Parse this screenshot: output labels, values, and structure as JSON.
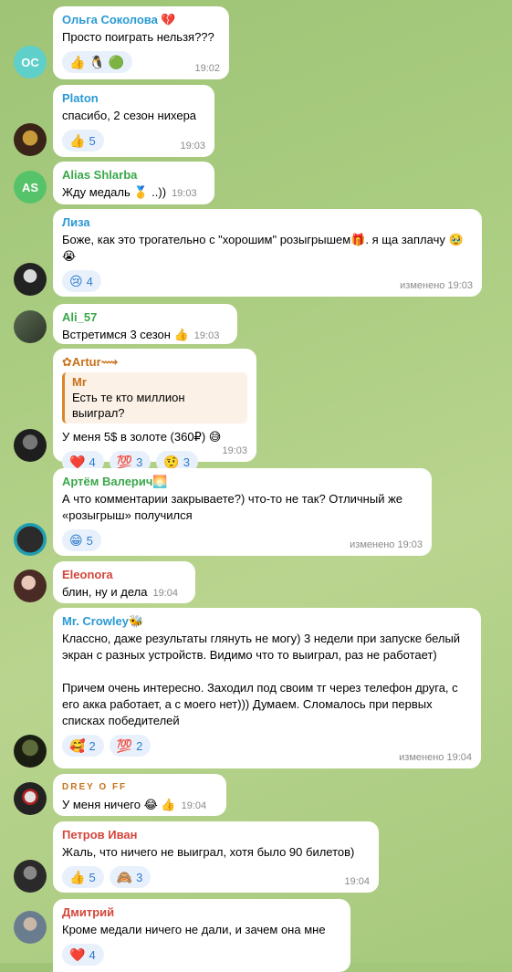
{
  "messages": [
    {
      "name": "Ольга Соколова 💔",
      "text": "Просто поиграть нельзя???",
      "time": "19:02",
      "initials": "ОС",
      "reactions": [
        {
          "emoji": "👍",
          "count": ""
        },
        {
          "emoji": "🐧",
          "count": ""
        },
        {
          "emoji": "🟢",
          "count": ""
        }
      ]
    },
    {
      "name": "Platon",
      "text": "спасибо, 2 сезон нихера",
      "time": "19:03",
      "reactions": [
        {
          "emoji": "👍",
          "count": "5"
        }
      ]
    },
    {
      "name": "Alias Shlarba",
      "text": "Жду медаль 🥇 ..))",
      "time": "19:03",
      "initials": "AS"
    },
    {
      "name": "Лиза",
      "text": "Боже, как это трогательно с \"хорошим\" розыгрышем🎁. я ща заплачу 🥹 😭",
      "time": "изменено 19:03",
      "reactions": [
        {
          "emoji": "😢",
          "count": "4"
        }
      ]
    },
    {
      "name": "Ali_57",
      "text": "Встретимся 3 сезон 👍",
      "time": "19:03"
    },
    {
      "name": "✿Artur⟿",
      "quote_name": "Mr",
      "quote_text": "Есть те кто миллион выиграл?",
      "text": "У меня 5$ в золоте (360₽) 😅",
      "time": "19:03",
      "reactions": [
        {
          "emoji": "❤️",
          "count": "4"
        },
        {
          "emoji": "💯",
          "count": "3"
        },
        {
          "emoji": "🤨",
          "count": "3"
        }
      ]
    },
    {
      "name": "Артём Валерич🌅",
      "text": "А что комментарии закрываете?) что-то не так? Отличный же «розыгрыш» получился",
      "time": "изменено 19:03",
      "reactions": [
        {
          "emoji": "😁",
          "count": "5"
        }
      ]
    },
    {
      "name": "Eleonora",
      "text": "блин, ну и дела",
      "time": "19:04"
    },
    {
      "name": "Mr. Crowley🐝",
      "text": "Классно, даже результаты глянуть не могу) 3 недели при запуске белый экран с разных устройств. Видимо что то выиграл, раз не работает)\n\nПричем очень интересно. Заходил под своим тг через телефон друга, с его акка работает, а с моего нет))) Думаем. Сломалось при первых списках победителей",
      "time": "изменено 19:04",
      "reactions": [
        {
          "emoji": "🥰",
          "count": "2"
        },
        {
          "emoji": "💯",
          "count": "2"
        }
      ]
    },
    {
      "name": "DREY O FF",
      "text": "У меня ничего 😂 👍",
      "time": "19:04"
    },
    {
      "name": "Петров Иван",
      "text": "Жаль, что ничего не выиграл, хотя было 90 билетов)",
      "time": "19:04",
      "reactions": [
        {
          "emoji": "👍",
          "count": "5"
        },
        {
          "emoji": "🙈",
          "count": "3"
        }
      ]
    },
    {
      "name": "Дмитрий",
      "text": "Кроме медали ничего не дали, и зачем она мне",
      "reactions": [
        {
          "emoji": "❤️",
          "count": "4"
        }
      ]
    }
  ]
}
